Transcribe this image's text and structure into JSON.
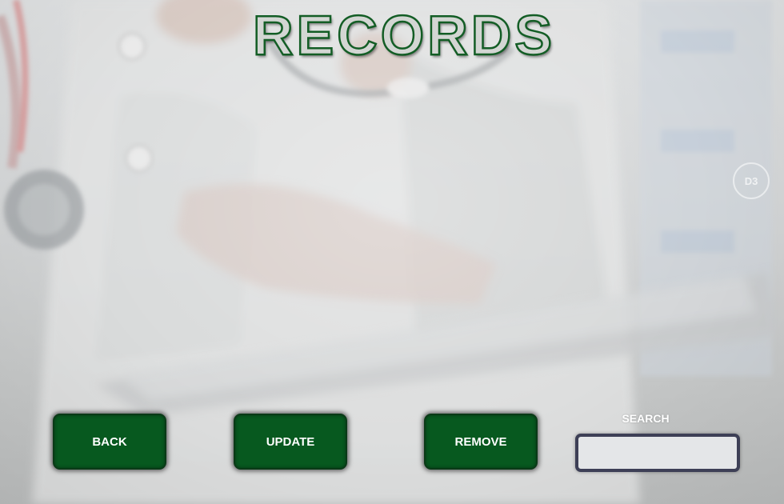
{
  "window": {
    "title": "RECORDS"
  },
  "actions": {
    "back_label": "BACK",
    "update_label": "UPDATE",
    "remove_label": "REMOVE"
  },
  "search": {
    "label": "SEARCH",
    "value": "",
    "placeholder": ""
  },
  "background": {
    "description_icon": "doctor-tablet-photo"
  },
  "colors": {
    "button_green": "#07591f",
    "title_outline": "#135d25",
    "search_border": "#3d3f56"
  }
}
